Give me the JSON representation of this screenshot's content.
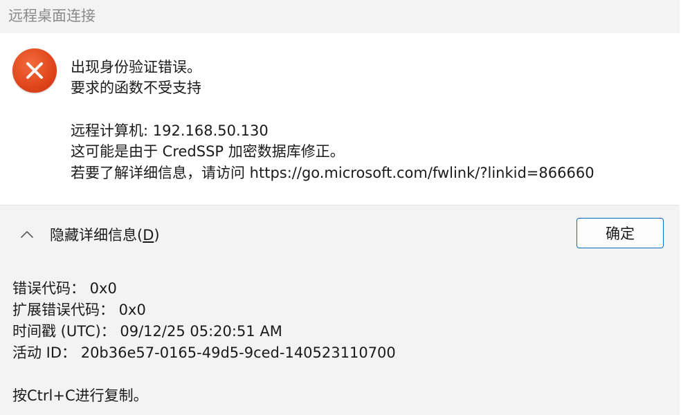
{
  "window": {
    "title": "远程桌面连接"
  },
  "message": {
    "icon": "error-icon",
    "line1": "出现身份验证错误。",
    "line2": "要求的函数不受支持",
    "line3": "远程计算机: 192.168.50.130",
    "line4": "这可能是由于 CredSSP 加密数据库修正。",
    "line5": "若要了解详细信息，请访问 https://go.microsoft.com/fwlink/?linkid=866660"
  },
  "footer": {
    "toggle_icon": "chevron-up-icon",
    "toggle_label_prefix": "隐藏详细信息(",
    "toggle_label_accel": "D",
    "toggle_label_suffix": ")",
    "ok_label": "确定"
  },
  "details": {
    "error_code": "错误代码： 0x0",
    "ext_error_code": "扩展错误代码： 0x0",
    "timestamp": "时间戳 (UTC)： 09/12/25 05:20:51 AM",
    "activity_id": "活动 ID： 20b36e57-0165-49d5-9ced-140523110700",
    "copy_hint": "按Ctrl+C进行复制。"
  },
  "colors": {
    "error_red": "#e0451b",
    "button_border": "#0067c0",
    "panel_gray": "#f3f3f3"
  }
}
